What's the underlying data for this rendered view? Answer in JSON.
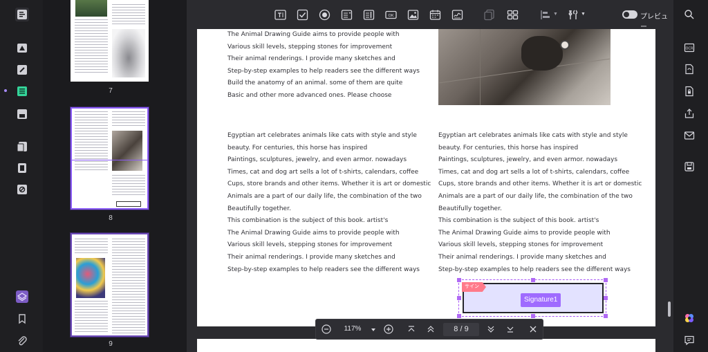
{
  "toolbar": {
    "preview_label": "プレビュー",
    "icons": [
      "text-field-icon",
      "checkbox-icon",
      "radio-button-icon",
      "dropdown-icon",
      "list-box-icon",
      "button-ok-icon",
      "image-field-icon",
      "date-field-icon",
      "signature-field-icon",
      "duplicate-icon",
      "grid-icon",
      "align-icon",
      "tools-icon"
    ]
  },
  "thumbnails": [
    {
      "page": "7"
    },
    {
      "page": "8"
    },
    {
      "page": "9"
    }
  ],
  "document": {
    "left_top_lines": [
      "The Animal Drawing Guide aims to provide people with",
      "Various skill levels, stepping stones for improvement",
      "Their animal renderings. I provide many sketches and",
      "Step-by-step examples to help readers see the different ways",
      "Build the anatomy of an animal. some of them are quite",
      "Basic and other more advanced ones. Please choose"
    ],
    "left_lines": [
      "Egyptian art celebrates animals like cats with style and style",
      "beauty. For centuries, this horse has inspired",
      "Paintings, sculptures, jewelry, and even armor. nowadays",
      "Times, cat and dog art sells a lot of t-shirts, calendars, coffee",
      "Cups, store brands and other items. Whether it is art or domestic",
      "Animals are a part of our daily life, the combination of the two",
      "Beautifully together.",
      "This combination is the subject of this book. artist's",
      "The Animal Drawing Guide aims to provide people with",
      "Various skill levels, stepping stones for improvement",
      "Their animal renderings. I provide many sketches and",
      "Step-by-step examples to help readers see the different ways"
    ],
    "right_lines": [
      "Egyptian art celebrates animals like cats with style and style",
      "beauty. For centuries, this horse has inspired",
      "Paintings, sculptures, jewelry, and even armor. nowadays",
      "Times, cat and dog art sells a lot of t-shirts, calendars, coffee",
      "Cups, store brands and other items. Whether it is art or domestic",
      "Animals are a part of our daily life, the combination of the two",
      "Beautifully together.",
      "This combination is the subject of this book. artist's",
      "The Animal Drawing Guide aims to provide people with",
      "Various skill levels, stepping stones for improvement",
      "Their animal renderings. I provide many sketches and",
      "Step-by-step examples to help readers see the different ways"
    ],
    "signature": {
      "tag": "サイン",
      "label": "Signature1"
    }
  },
  "bottom_bar": {
    "zoom": "117%",
    "page_current": "8",
    "page_total": "9"
  },
  "colors": {
    "accent": "#8b5cf6",
    "signature_fill": "#e3e2ff",
    "signature_tag": "#ff7a8a"
  }
}
